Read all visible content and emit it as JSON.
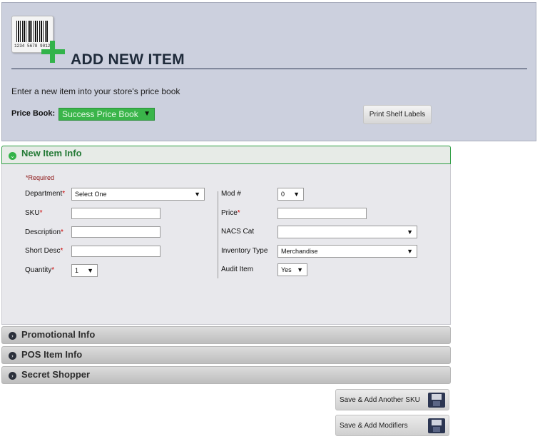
{
  "header": {
    "barcode_number": "1234 5678 9012",
    "title": "ADD NEW ITEM",
    "subtitle": "Enter a new item into your store's price book",
    "price_book_label": "Price Book:",
    "price_book_value": "Success Price Book",
    "print_button": "Print Shelf Labels"
  },
  "sections": {
    "new_item": "New Item Info",
    "promotional": "Promotional Info",
    "pos": "POS Item Info",
    "secret_shopper": "Secret Shopper"
  },
  "form": {
    "required_note": "*Required",
    "department": {
      "label": "Department",
      "value": "Select One"
    },
    "sku": {
      "label": "SKU",
      "value": ""
    },
    "description": {
      "label": "Description",
      "value": ""
    },
    "short_desc": {
      "label": "Short Desc",
      "value": ""
    },
    "quantity": {
      "label": "Quantity",
      "value": "1"
    },
    "mod": {
      "label": "Mod #",
      "value": "0"
    },
    "price": {
      "label": "Price",
      "value": ""
    },
    "nacs_cat": {
      "label": "NACS Cat",
      "value": ""
    },
    "inventory_type": {
      "label": "Inventory Type",
      "value": "Merchandise"
    },
    "audit_item": {
      "label": "Audit Item",
      "value": "Yes"
    },
    "required_marker": "*"
  },
  "buttons": {
    "save_add_sku": "Save & Add Another SKU",
    "save_add_modifiers": "Save & Add Modifiers"
  },
  "icons": {
    "arrow_down": "▼",
    "expand": "⌄",
    "collapsed": "›"
  },
  "colors": {
    "accent_green": "#3ab54a",
    "header_bg": "#ccd0de",
    "required_red": "#cc0000"
  }
}
